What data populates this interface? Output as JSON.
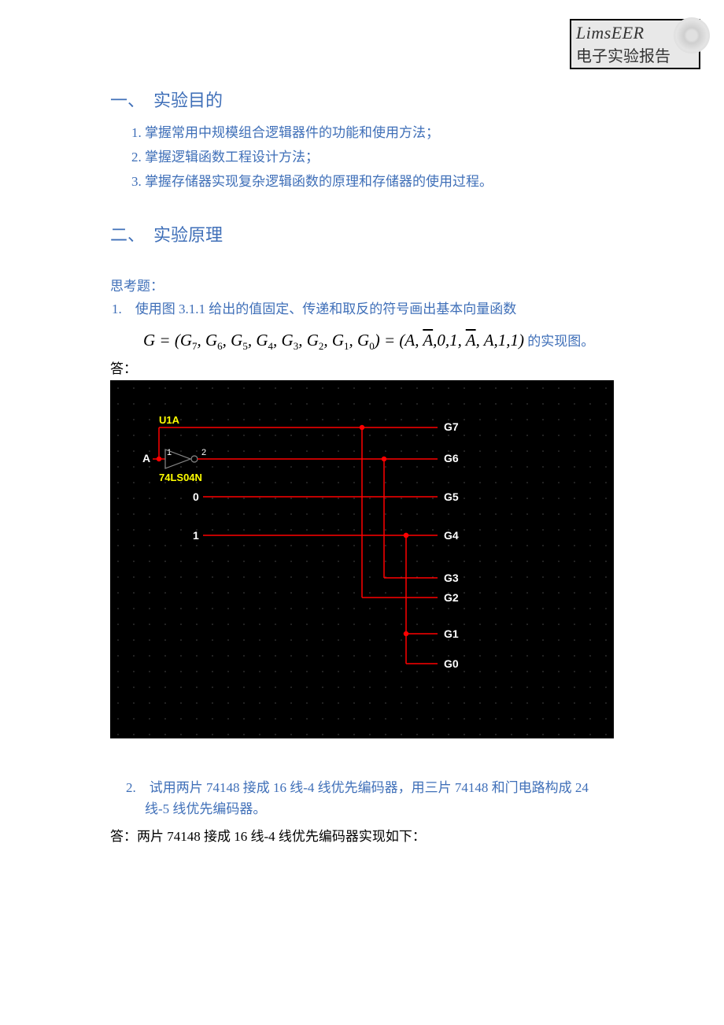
{
  "logo": {
    "en": "LimsEER",
    "cn": "电子实验报告"
  },
  "section1": {
    "title": "一、　实验目的",
    "items": [
      "掌握常用中规模组合逻辑器件的功能和使用方法；",
      "掌握逻辑函数工程设计方法；",
      "掌握存储器实现复杂逻辑函数的原理和存储器的使用过程。"
    ]
  },
  "section2": {
    "title": "二、　实验原理"
  },
  "think": "思考题：",
  "q1": {
    "lead": "1.　使用图 3.1.1 给出的值固定、传递和取反的符号画出基本向量函数",
    "formula_trail": " 的实现图。"
  },
  "answer_label": "答：",
  "circuit": {
    "component": "U1A",
    "chip": "74LS04N",
    "input": "A",
    "pin1": "1",
    "pin2": "2",
    "const0": "0",
    "const1": "1",
    "outputs": [
      "G7",
      "G6",
      "G5",
      "G4",
      "G3",
      "G2",
      "G1",
      "G0"
    ]
  },
  "q2": {
    "text": "2.　试用两片 74148 接成 16 线-4 线优先编码器，用三片 74148 和门电路构成 24 线-5 线优先编码器。"
  },
  "ans2": "答：两片 74148 接成 16 线-4 线优先编码器实现如下："
}
